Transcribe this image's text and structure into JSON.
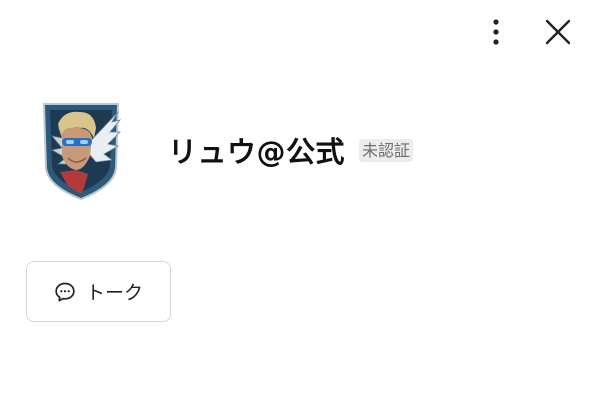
{
  "header": {
    "more_icon": "more-vertical-icon",
    "close_icon": "close-icon"
  },
  "profile": {
    "name": "リュウ@公式",
    "badge": "未認証",
    "avatar": "survey-corps-emblem-avatar"
  },
  "actions": {
    "talk_label": "トーク",
    "talk_icon": "chat-bubble-icon"
  }
}
